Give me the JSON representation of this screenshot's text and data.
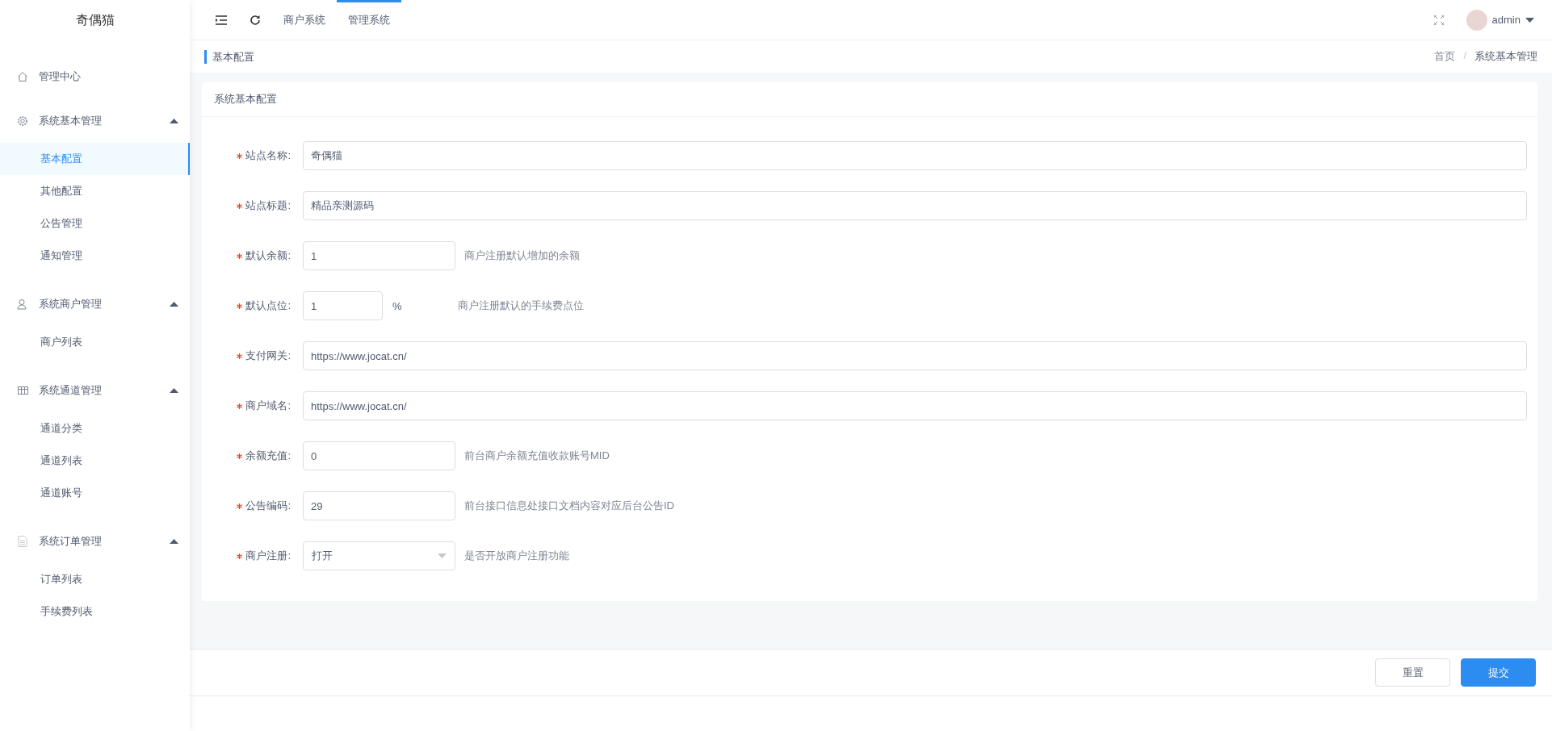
{
  "sidebar": {
    "logo": "奇偶猫",
    "items": [
      {
        "label": "管理中心"
      },
      {
        "label": "系统基本管理",
        "expanded": true,
        "children": [
          {
            "label": "基本配置",
            "selected": true
          },
          {
            "label": "其他配置",
            "selected": false
          },
          {
            "label": "公告管理",
            "selected": false
          },
          {
            "label": "通知管理",
            "selected": false
          }
        ]
      },
      {
        "label": "系统商户管理",
        "expanded": true,
        "children": [
          {
            "label": "商户列表",
            "selected": false
          }
        ]
      },
      {
        "label": "系统通道管理",
        "expanded": true,
        "children": [
          {
            "label": "通道分类",
            "selected": false
          },
          {
            "label": "通道列表",
            "selected": false
          },
          {
            "label": "通道账号",
            "selected": false
          }
        ]
      },
      {
        "label": "系统订单管理",
        "expanded": true,
        "children": [
          {
            "label": "订单列表",
            "selected": false
          },
          {
            "label": "手续费列表",
            "selected": false
          }
        ]
      }
    ]
  },
  "topbar": {
    "tabs": [
      {
        "label": "商户系统",
        "selected": false
      },
      {
        "label": "管理系统",
        "selected": true
      }
    ],
    "user": "admin"
  },
  "page_header": {
    "title": "基本配置",
    "breadcrumb": [
      "首页",
      "系统基本管理"
    ],
    "breadcrumb_separator": "/"
  },
  "card": {
    "title": "系统基本配置",
    "fields": [
      {
        "label": "站点名称:",
        "required": true,
        "kind": "wide",
        "value": "奇偶猫"
      },
      {
        "label": "站点标题:",
        "required": true,
        "kind": "wide",
        "value": "精品亲测源码"
      },
      {
        "label": "默认余额:",
        "required": true,
        "kind": "short",
        "value": "1",
        "hint": "商户注册默认增加的余额"
      },
      {
        "label": "默认点位:",
        "required": true,
        "kind": "narrow",
        "value": "1",
        "suffix": "%",
        "hint": "商户注册默认的手续费点位"
      },
      {
        "label": "支付网关:",
        "required": true,
        "kind": "wide",
        "value": "https://www.jocat.cn/"
      },
      {
        "label": "商户域名:",
        "required": true,
        "kind": "wide",
        "value": "https://www.jocat.cn/"
      },
      {
        "label": "余额充值:",
        "required": true,
        "kind": "short",
        "value": "0",
        "hint": "前台商户余额充值收款账号MID"
      },
      {
        "label": "公告编码:",
        "required": true,
        "kind": "short",
        "value": "29",
        "hint": "前台接口信息处接口文档内容对应后台公告ID"
      },
      {
        "label": "商户注册:",
        "required": true,
        "kind": "select",
        "value": "打开",
        "hint": "是否开放商户注册功能"
      }
    ]
  },
  "footer": {
    "buttons": [
      {
        "label": "重置",
        "kind": "default"
      },
      {
        "label": "提交",
        "kind": "primary"
      }
    ]
  }
}
